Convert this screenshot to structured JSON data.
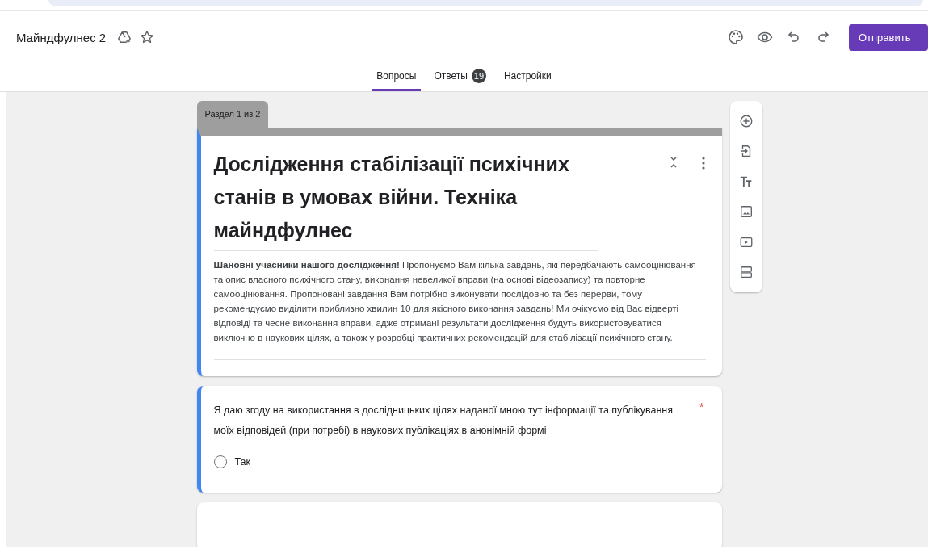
{
  "header": {
    "title": "Майндфулнес 2",
    "send_button": "Отправить"
  },
  "tabs": [
    {
      "label": "Вопросы",
      "selected": true
    },
    {
      "label": "Ответы",
      "selected": false,
      "badge": "19"
    },
    {
      "label": "Настройки",
      "selected": false
    }
  ],
  "section_tab": "Раздел 1 из 2",
  "form": {
    "title": "Дослідження стабілізації психічних станів в умовах війни. Техніка майндфулнес",
    "description": "**Шановні учасники нашого дослідження!** Пропонуємо Вам кілька завдань, які передбачають самооцінювання та опис власного психічного стану, виконання невеликої вправи (на основі відеозапису) та повторне самооцінювання. Пропоновані завдання Вам потрібно виконувати послідовно та без перерви, тому рекомендуємо виділити приблизно хвилин 10 для якісного виконання завдань! Ми очікуємо від Вас відверті відповіді та чесне виконання вправи, адже отримані результати дослідження будуть використовуватися виключно в наукових цілях, а також у розробці практичних рекомендацій для стабілізації психічного стану."
  },
  "questions": [
    {
      "text": "Я даю згоду на використання в дослідницьких цілях наданої мною тут інформації та публікування моїх відповідей (при потребі) в наукових публікаціях в анонімній формі",
      "required": true,
      "required_mark": "*",
      "options": [
        {
          "label": "Так",
          "selected": false
        }
      ]
    }
  ]
}
